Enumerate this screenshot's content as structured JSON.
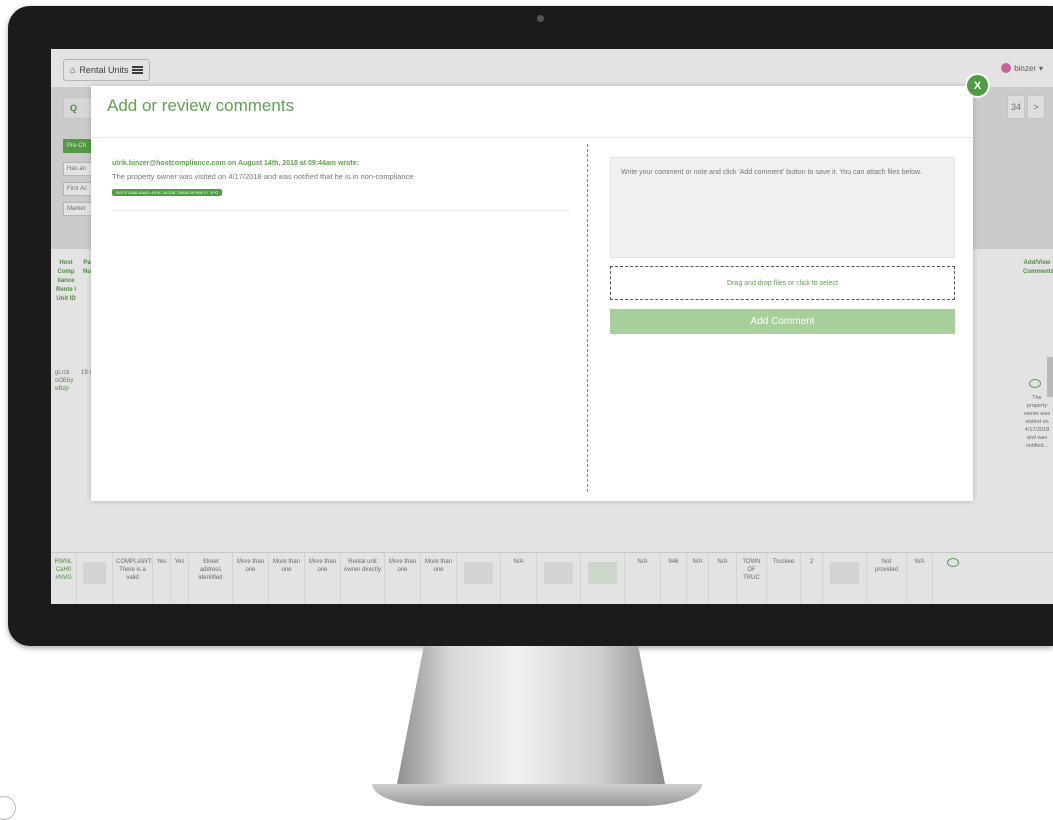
{
  "app": {
    "nav_chip_label": "Rental Units",
    "user_name": "binzer",
    "search_prefix": "Q",
    "pager": [
      "34",
      ">"
    ],
    "filters": [
      "Pre-Ch",
      "Has an",
      "First Ac",
      "Market"
    ]
  },
  "table": {
    "headers": [
      "Host Comp liance Rente l Unit ID",
      "Pa Nu",
      "Add/View Comments"
    ],
    "row1_id": "gLrzk oOEby eBzp",
    "row1_num": "19 0",
    "side_comment": "The property owner was visited on 4/17/2018 and was notified...",
    "bottom_row": [
      "RWNL CaH0 #NVG",
      "",
      "COMPLIANT: There is a valid",
      "Yes",
      "Yes",
      "Street address identified",
      "More than one",
      "More than one",
      "More than one",
      "Rental unit owner directly",
      "More than one",
      "More than one",
      "",
      "N/A",
      "",
      "",
      "N/A",
      "946",
      "N/A",
      "N/A",
      "TOWN OF TRUC",
      "Truckee",
      "2",
      "",
      "Not provided",
      "N/A"
    ]
  },
  "modal": {
    "title": "Add or review comments",
    "close_label": "X",
    "comments": [
      {
        "author_line": "ulrik.binzer@hostcompliance.com on August 14th, 2018 at 09:44am wrote:",
        "text": "The property owner was visited on 4/17/2018 and was notified that he is in non-compliance",
        "attachment": "DSCF1386-4A6D-4E9C-BCDB-7BE8C9F9BE17.JPG"
      }
    ],
    "input_placeholder": "Write your comment or note and click 'Add comment' button to save it. You can attach files below.",
    "dropzone_label": "Drag and drop files or click to select",
    "add_button_label": "Add Comment"
  },
  "colors": {
    "brand_green": "#5fa34e",
    "button_green": "#a7cf9b",
    "close_green": "#4f9d43"
  }
}
